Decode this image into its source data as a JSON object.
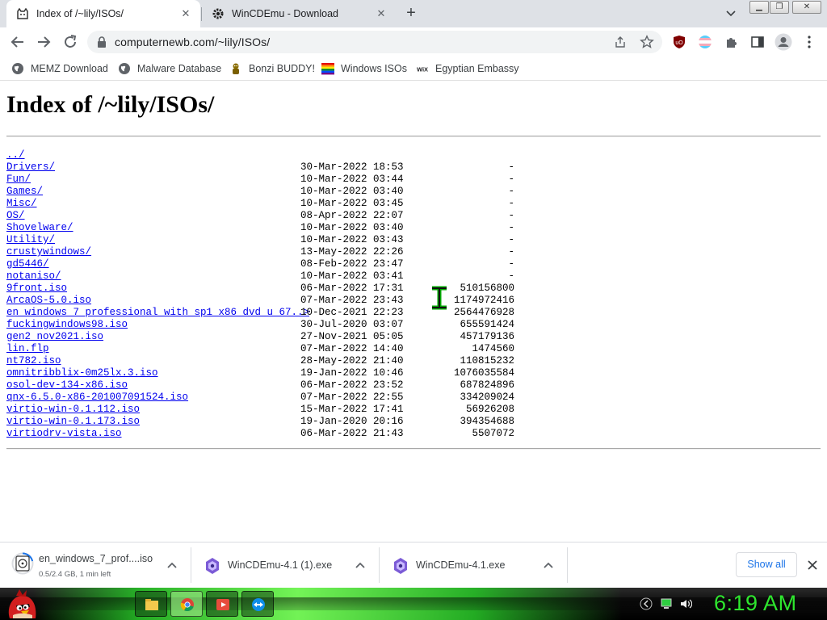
{
  "tabs": [
    {
      "title": "Index of /~lily/ISOs/",
      "active": true,
      "icon": "cat-favicon-icon"
    },
    {
      "title": "WinCDEmu - Download",
      "active": false,
      "icon": "gear-favicon-icon"
    }
  ],
  "address_bar": {
    "url": "computernewb.com/~lily/ISOs/"
  },
  "bookmarks": [
    {
      "label": "MEMZ Download",
      "icon": "globe-icon"
    },
    {
      "label": "Malware Database",
      "icon": "globe-icon"
    },
    {
      "label": "Bonzi BUDDY!",
      "icon": "bonzi-icon"
    },
    {
      "label": "Windows ISOs",
      "icon": "rainbow-flag-icon"
    },
    {
      "label": "Egyptian Embassy",
      "icon": "wix-icon"
    }
  ],
  "page": {
    "heading": "Index of /~lily/ISOs/",
    "entries": [
      {
        "name": "../",
        "date": "",
        "size": ""
      },
      {
        "name": "Drivers/",
        "date": "30-Mar-2022 18:53",
        "size": "-"
      },
      {
        "name": "Fun/",
        "date": "10-Mar-2022 03:44",
        "size": "-"
      },
      {
        "name": "Games/",
        "date": "10-Mar-2022 03:40",
        "size": "-"
      },
      {
        "name": "Misc/",
        "date": "10-Mar-2022 03:45",
        "size": "-"
      },
      {
        "name": "OS/",
        "date": "08-Apr-2022 22:07",
        "size": "-"
      },
      {
        "name": "Shovelware/",
        "date": "10-Mar-2022 03:40",
        "size": "-"
      },
      {
        "name": "Utility/",
        "date": "10-Mar-2022 03:43",
        "size": "-"
      },
      {
        "name": "crustywindows/",
        "date": "13-May-2022 22:26",
        "size": "-"
      },
      {
        "name": "gd5446/",
        "date": "08-Feb-2022 23:47",
        "size": "-"
      },
      {
        "name": "notaniso/",
        "date": "10-Mar-2022 03:41",
        "size": "-"
      },
      {
        "name": "9front.iso",
        "date": "06-Mar-2022 17:31",
        "size": "510156800"
      },
      {
        "name": "ArcaOS-5.0.iso",
        "date": "07-Mar-2022 23:43",
        "size": "1174972416"
      },
      {
        "name": "en_windows_7_professional_with_sp1_x86_dvd_u_67..>",
        "date": "10-Dec-2021 22:23",
        "size": "2564476928"
      },
      {
        "name": "fuckingwindows98.iso",
        "date": "30-Jul-2020 03:07",
        "size": "655591424"
      },
      {
        "name": "gen2_nov2021.iso",
        "date": "27-Nov-2021 05:05",
        "size": "457179136"
      },
      {
        "name": "lin.flp",
        "date": "07-Mar-2022 14:40",
        "size": "1474560"
      },
      {
        "name": "nt782.iso",
        "date": "28-May-2022 21:40",
        "size": "110815232"
      },
      {
        "name": "omnitribblix-0m25lx.3.iso",
        "date": "19-Jan-2022 10:46",
        "size": "1076035584"
      },
      {
        "name": "osol-dev-134-x86.iso",
        "date": "06-Mar-2022 23:52",
        "size": "687824896"
      },
      {
        "name": "qnx-6.5.0-x86-201007091524.iso",
        "date": "07-Mar-2022 22:55",
        "size": "334209024"
      },
      {
        "name": "virtio-win-0.1.112.iso",
        "date": "15-Mar-2022 17:41",
        "size": "56926208"
      },
      {
        "name": "virtio-win-0.1.173.iso",
        "date": "19-Jan-2020 20:16",
        "size": "394354688"
      },
      {
        "name": "virtiodrv-vista.iso",
        "date": "06-Mar-2022 21:43",
        "size": "5507072"
      }
    ]
  },
  "downloads": [
    {
      "filename": "en_windows_7_prof....iso",
      "status": "0.5/2.4 GB, 1 min left",
      "progress": 0.21,
      "icon": "iso-file-icon"
    },
    {
      "filename": "WinCDEmu-4.1 (1).exe",
      "icon": "wincdemu-icon"
    },
    {
      "filename": "WinCDEmu-4.1.exe",
      "icon": "wincdemu-icon"
    }
  ],
  "download_shelf": {
    "show_all_label": "Show all"
  },
  "taskbar": {
    "clock": "6:19 AM",
    "apps": [
      "file-explorer-icon",
      "chrome-icon",
      "media-player-icon",
      "teamviewer-icon"
    ]
  },
  "colors": {
    "link": "#0000ee",
    "clock": "#2ee62e",
    "accent": "#1a73e8"
  }
}
